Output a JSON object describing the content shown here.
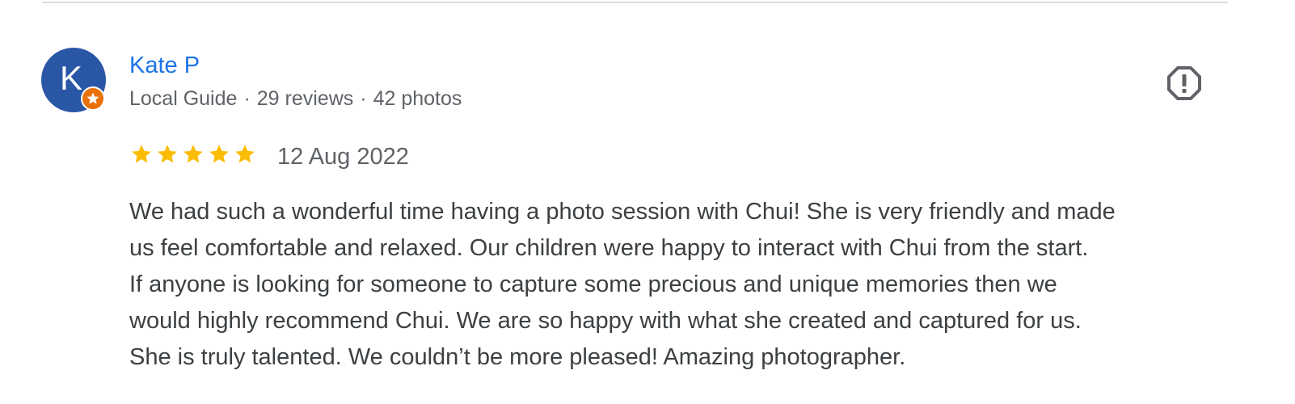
{
  "review": {
    "avatar_letter": "K",
    "avatar_color": "#2a56a6",
    "badge_color": "#e8710a",
    "author_name": "Kate P",
    "author_role": "Local Guide",
    "review_count": "29 reviews",
    "photo_count": "42 photos",
    "separator": "·",
    "rating": 5,
    "star_color": "#fbbc04",
    "date": "12 Aug 2022",
    "text_lines": [
      "We had such a wonderful time having a photo session with Chui! She is very friendly and made",
      "us feel comfortable and relaxed. Our children were happy to interact with Chui from the start.",
      "If anyone is looking for someone to capture some precious and unique memories then we",
      "would highly recommend Chui. We are so happy with what she created and captured for us.",
      "She is truly talented. We couldn’t be more pleased! Amazing photographer."
    ],
    "report_icon": "report-octagon-icon"
  }
}
